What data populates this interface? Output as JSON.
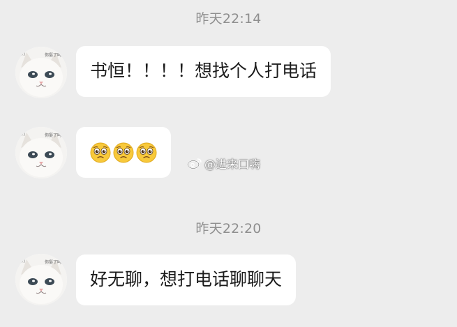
{
  "timestamps": [
    "昨天22:14",
    "昨天22:20"
  ],
  "messages": [
    {
      "text": "书恒！！！！想找个人打电话"
    },
    {
      "emojis": [
        "pleading-face",
        "pleading-face",
        "pleading-face"
      ]
    },
    {
      "text": "好无聊，想打电话聊聊天"
    }
  ],
  "watermark": {
    "handle": "@进来口嗨",
    "icon": "weibo-logo-icon"
  },
  "colors": {
    "background": "#ededed",
    "bubble": "#ffffff",
    "timestamp": "#8f8f8f",
    "text": "#1b1b1b"
  }
}
